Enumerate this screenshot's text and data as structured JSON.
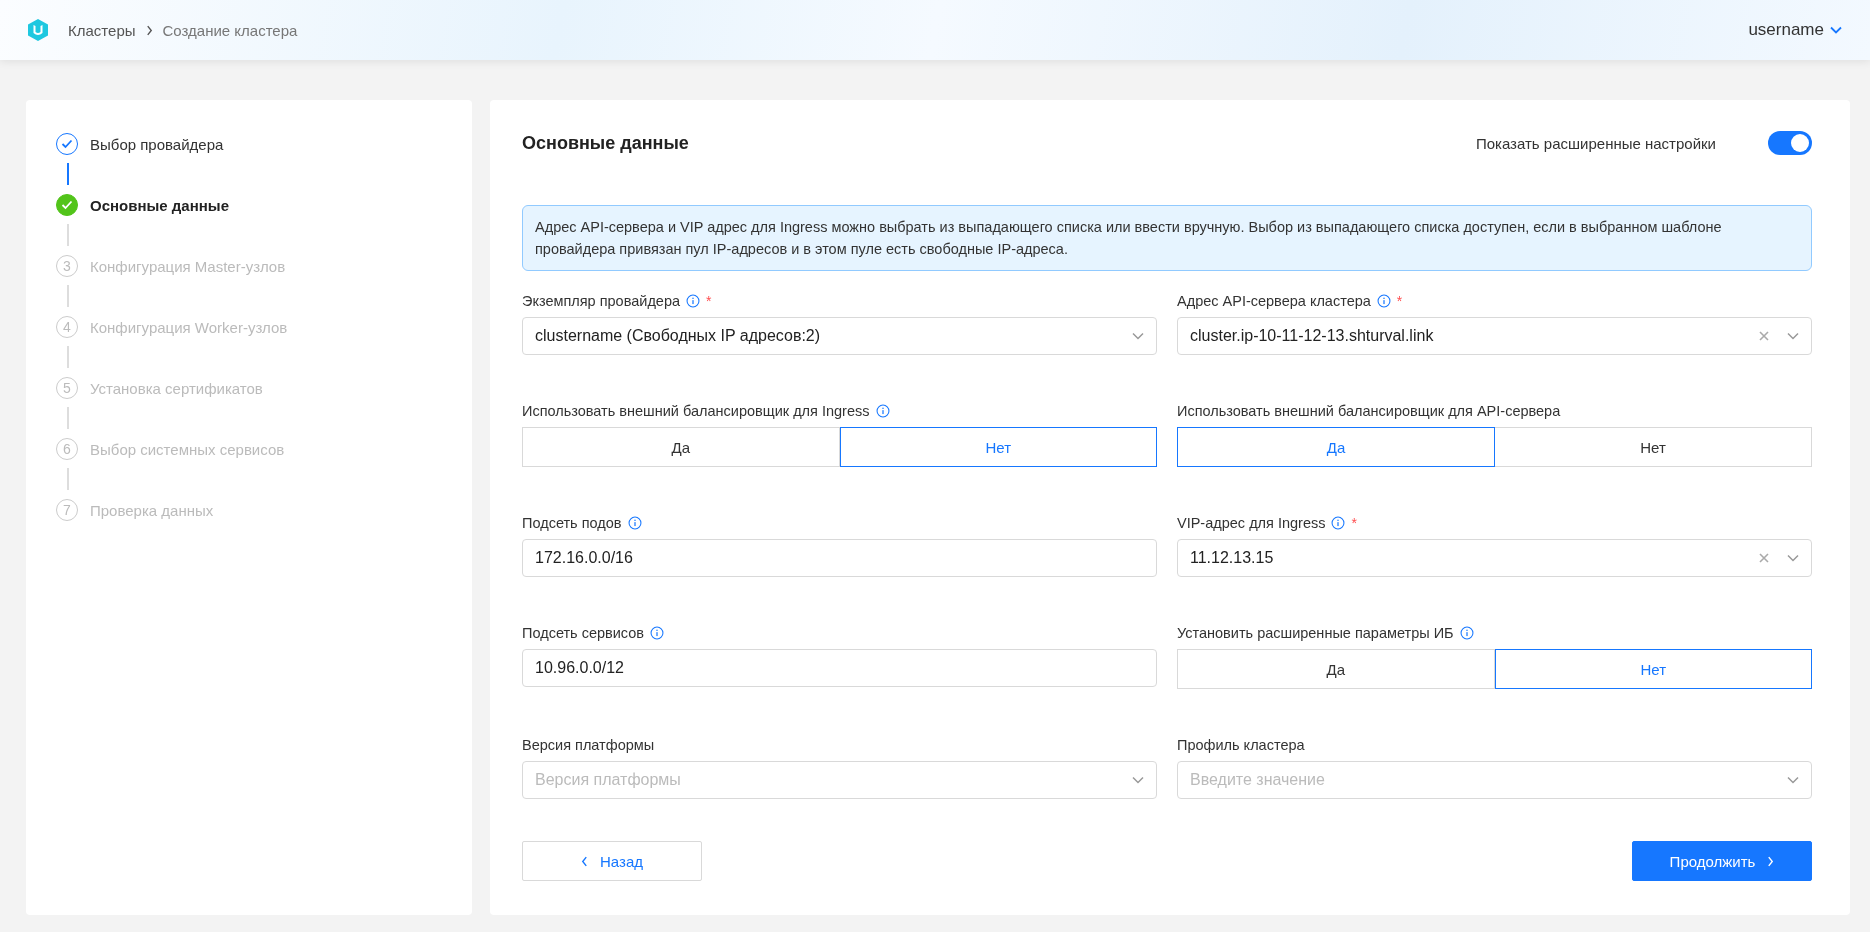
{
  "header": {
    "breadcrumbs": [
      "Кластеры",
      "Создание кластера"
    ],
    "user": "username"
  },
  "steps": [
    {
      "label": "Выбор провайдера",
      "kind": "done"
    },
    {
      "label": "Основные данные",
      "kind": "current"
    },
    {
      "label": "Конфигурация Master-узлов",
      "kind": "pending",
      "number": "3"
    },
    {
      "label": "Конфигурация Worker-узлов",
      "kind": "pending",
      "number": "4"
    },
    {
      "label": "Установка сертификатов",
      "kind": "pending",
      "number": "5"
    },
    {
      "label": "Выбор системных сервисов",
      "kind": "pending",
      "number": "6"
    },
    {
      "label": "Проверка данных",
      "kind": "pending",
      "number": "7"
    }
  ],
  "form": {
    "title": "Основные данные",
    "advanced": {
      "label": "Показать расширенные настройки",
      "on": true
    },
    "info": "Адрес API-сервера и VIP адрес для Ingress можно выбрать из выпадающего списка или ввести вручную. Выбор из выпадающего списка доступен, если в выбранном шаблоне провайдера привязан пул IP-адресов и в этом пуле есть свободные IP-адреса.",
    "fields": [
      {
        "kind": "select",
        "label": "Экземпляр провайдера",
        "info": true,
        "required_mark": "*",
        "value": "clustername (Свободных IP адресов:2)",
        "clearable": false
      },
      {
        "kind": "select",
        "label": "Адрес API-сервера кластера",
        "info": true,
        "required_mark": "*",
        "value": "cluster.ip-10-11-12-13.shturval.link",
        "clearable": true
      },
      {
        "kind": "segmented",
        "label": "Использовать внешний балансировщик для Ingress",
        "info": true,
        "options": [
          {
            "label": "Да",
            "selected": false
          },
          {
            "label": "Нет",
            "selected": true
          }
        ]
      },
      {
        "kind": "segmented",
        "label": "Использовать внешний балансировщик для API-сервера",
        "info": false,
        "options": [
          {
            "label": "Да",
            "selected": true
          },
          {
            "label": "Нет",
            "selected": false
          }
        ]
      },
      {
        "kind": "input",
        "label": "Подсеть подов",
        "info": true,
        "value": "172.16.0.0/16"
      },
      {
        "kind": "select",
        "label": "VIP-адрес для Ingress",
        "info": true,
        "required_mark": "*",
        "value": "11.12.13.15",
        "clearable": true
      },
      {
        "kind": "input",
        "label": "Подсеть сервисов",
        "info": true,
        "value": "10.96.0.0/12"
      },
      {
        "kind": "segmented",
        "label": "Установить расширенные параметры ИБ",
        "info": true,
        "options": [
          {
            "label": "Да",
            "selected": false
          },
          {
            "label": "Нет",
            "selected": true
          }
        ]
      },
      {
        "kind": "select",
        "label": "Версия платформы",
        "info": false,
        "placeholder": "Версия платформы",
        "clearable": false
      },
      {
        "kind": "select",
        "label": "Профиль кластера",
        "info": false,
        "placeholder": "Введите значение",
        "clearable": false
      }
    ],
    "back": "Назад",
    "next": "Продолжить"
  }
}
